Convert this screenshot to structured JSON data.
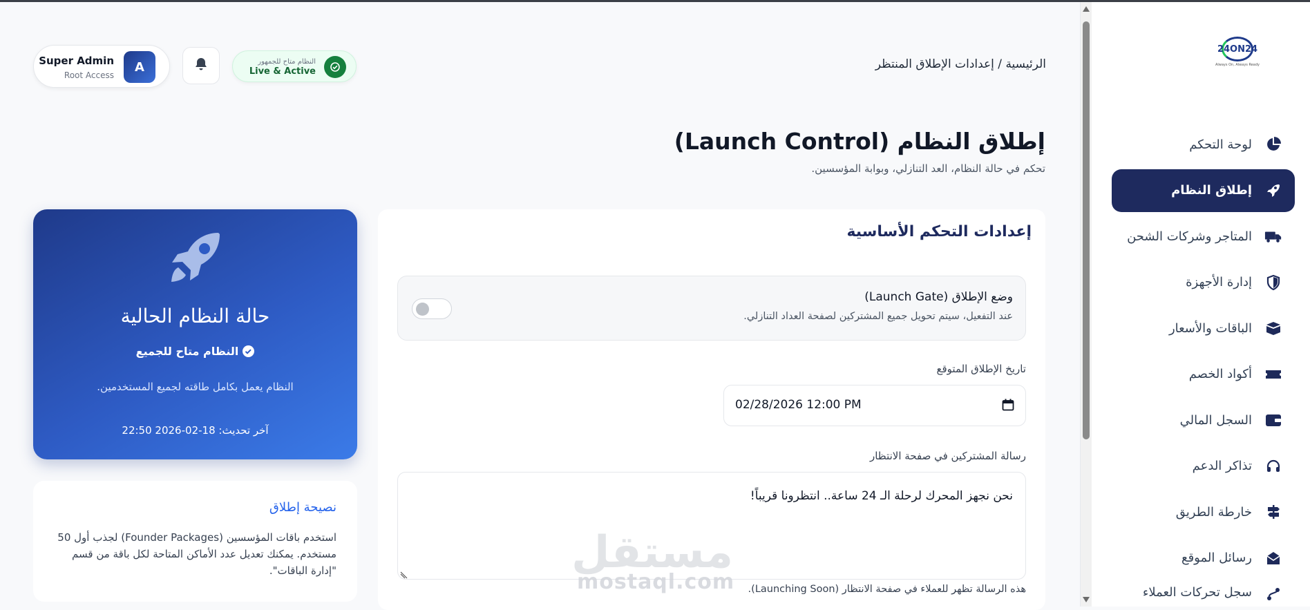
{
  "app": {
    "logo_text": "24ON24",
    "logo_tagline": "Always On, Always Ready"
  },
  "header": {
    "breadcrumb": "الرئيسية / إعدادات الإطلاق المنتظر",
    "user_name": "Super Admin",
    "user_role": "Root Access",
    "avatar_letter": "A",
    "status_small": "النظام متاح للجمهور",
    "status_main": "Live & Active"
  },
  "sidebar": {
    "items": [
      {
        "label": "لوحة التحكم",
        "icon": "pie-chart-icon"
      },
      {
        "label": "إطلاق النظام",
        "icon": "rocket-icon",
        "active": true
      },
      {
        "label": "المتاجر وشركات الشحن",
        "icon": "truck-icon"
      },
      {
        "label": "إدارة الأجهزة",
        "icon": "shield-icon"
      },
      {
        "label": "الباقات والأسعار",
        "icon": "box-icon"
      },
      {
        "label": "أكواد الخصم",
        "icon": "ticket-icon"
      },
      {
        "label": "السجل المالي",
        "icon": "wallet-icon"
      },
      {
        "label": "تذاكر الدعم",
        "icon": "headset-icon"
      },
      {
        "label": "خارطة الطريق",
        "icon": "signpost-icon"
      },
      {
        "label": "رسائل الموقع",
        "icon": "envelope-icon"
      },
      {
        "label": "سجل تحركات العملاء",
        "icon": "route-icon"
      }
    ]
  },
  "page": {
    "title": "إطلاق النظام (Launch Control)",
    "subtitle": "تحكم في حالة النظام، العد التنازلي، وبوابة المؤسسين."
  },
  "settings": {
    "title": "إعدادات التحكم الأساسية",
    "launch_gate_title": "وضع الإطلاق (Launch Gate)",
    "launch_gate_desc": "عند التفعيل، سيتم تحويل جميع المشتركين لصفحة العداد التنازلي.",
    "launch_gate_enabled": false,
    "date_label": "تاريخ الإطلاق المتوقع",
    "date_value": "02/28/2026 12:00 PM",
    "message_label": "رسالة المشتركين في صفحة الانتظار",
    "message_value": "نحن نجهز المحرك لرحلة الـ 24 ساعة.. انتظرونا قريباً!",
    "message_hint": "هذه الرسالة تظهر للعملاء في صفحة الانتظار (Launching Soon)."
  },
  "status_card": {
    "title": "حالة النظام الحالية",
    "status": "النظام متاح للجميع",
    "description": "النظام يعمل بكامل طاقته لجميع المستخدمين.",
    "updated": "آخر تحديث: 18-02-2026 22:50"
  },
  "tip_card": {
    "title": "نصيحة إطلاق",
    "text": "استخدم باقات المؤسسين (Founder Packages) لجذب أول 50 مستخدم. يمكنك تعديل عدد الأماكن المتاحة لكل باقة من قسم \"إدارة الباقات\"."
  },
  "watermark": {
    "text": "مستقل",
    "sub": "mostaql.com"
  },
  "colors": {
    "sidebar_active": "#1e2a5e",
    "status_card_start": "#1f3a8a",
    "status_card_end": "#3b7be8",
    "live_green": "#15803d",
    "tip_title": "#2563eb"
  }
}
